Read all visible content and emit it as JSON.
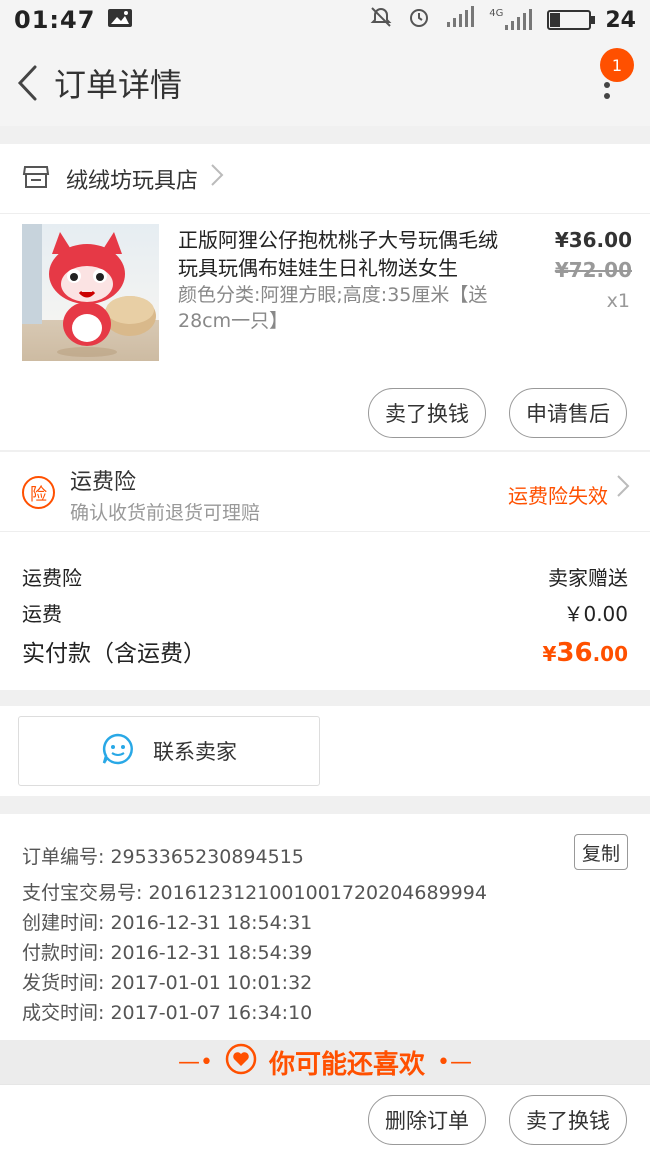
{
  "status_bar": {
    "time": "01:47",
    "network": "4G",
    "battery_level": "24",
    "battery_fraction": 0.24
  },
  "header": {
    "title": "订单详情",
    "notification_count": "1"
  },
  "shop": {
    "name": "绒绒坊玩具店"
  },
  "product": {
    "name": "正版阿狸公仔抱枕桃子大号玩偶毛绒玩具玩偶布娃娃生日礼物送女生",
    "spec": "颜色分类:阿狸方眼;高度:35厘米【送28cm一只】",
    "price": "¥36.00",
    "original_price": "¥72.00",
    "quantity": "x1",
    "actions": {
      "sell": "卖了换钱",
      "after_sale": "申请售后"
    }
  },
  "shipping_insurance": {
    "title": "运费险",
    "subtitle": "确认收货前退货可理赔",
    "status": "运费险失效"
  },
  "fees": {
    "insurance_label": "运费险",
    "insurance_value": "卖家赠送",
    "shipping_label": "运费",
    "shipping_value": "￥0.00",
    "total_label": "实付款（含运费）",
    "total_currency": "¥",
    "total_int": "36",
    "total_dec": ".00"
  },
  "contact": {
    "label": "联系卖家"
  },
  "order_info": {
    "order_no_label": "订单编号:",
    "order_no": "2953365230894515",
    "copy_label": "复制",
    "alipay_label": "支付宝交易号:",
    "alipay_no": "2016123121001001720204689994",
    "created_label": "创建时间:",
    "created": "2016-12-31 18:54:31",
    "paid_label": "付款时间:",
    "paid": "2016-12-31 18:54:39",
    "shipped_label": "发货时间:",
    "shipped": "2017-01-01 10:01:32",
    "done_label": "成交时间:",
    "done": "2017-01-07 16:34:10"
  },
  "recommend": {
    "title": "你可能还喜欢"
  },
  "bottom_bar": {
    "delete": "删除订单",
    "sell": "卖了换钱"
  },
  "colors": {
    "accent": "#ff5000",
    "icon_blue": "#29a8e6"
  }
}
